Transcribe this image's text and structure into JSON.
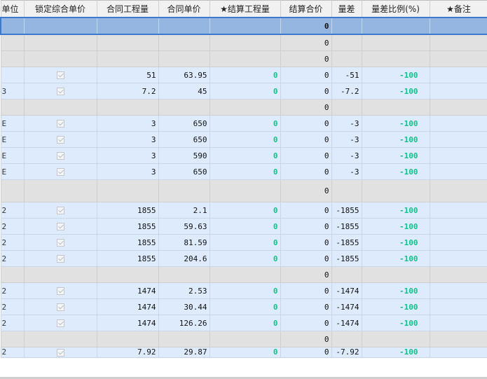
{
  "columns": [
    "单位",
    "锁定综合单价",
    "合同工程量",
    "合同单价",
    "★结算工程量",
    "结算合价",
    "量差",
    "量差比例(%)",
    "★备注"
  ],
  "rows": [
    {
      "type": "selected",
      "cells": [
        "",
        "",
        "",
        "",
        "",
        "0",
        "",
        "",
        ""
      ]
    },
    {
      "type": "group",
      "cells": [
        "",
        "",
        "",
        "",
        "",
        "0",
        "",
        "",
        ""
      ]
    },
    {
      "type": "group",
      "cells": [
        "",
        "",
        "",
        "",
        "",
        "0",
        "",
        "",
        ""
      ]
    },
    {
      "type": "item",
      "cells": [
        "",
        "",
        "51",
        "63.95",
        "0",
        "0",
        "-51",
        "-100",
        ""
      ]
    },
    {
      "type": "item",
      "cells": [
        "3",
        "",
        "7.2",
        "45",
        "0",
        "0",
        "-7.2",
        "-100",
        ""
      ]
    },
    {
      "type": "group",
      "cells": [
        "",
        "",
        "",
        "",
        "",
        "0",
        "",
        "",
        ""
      ]
    },
    {
      "type": "item",
      "cells": [
        "E",
        "",
        "3",
        "650",
        "0",
        "0",
        "-3",
        "-100",
        ""
      ]
    },
    {
      "type": "item",
      "cells": [
        "E",
        "",
        "3",
        "650",
        "0",
        "0",
        "-3",
        "-100",
        ""
      ]
    },
    {
      "type": "item",
      "cells": [
        "E",
        "",
        "3",
        "590",
        "0",
        "0",
        "-3",
        "-100",
        ""
      ]
    },
    {
      "type": "item",
      "cells": [
        "E",
        "",
        "3",
        "650",
        "0",
        "0",
        "-3",
        "-100",
        ""
      ]
    },
    {
      "type": "group tall",
      "cells": [
        "",
        "",
        "",
        "",
        "",
        "0",
        "",
        "",
        ""
      ]
    },
    {
      "type": "item",
      "cells": [
        "2",
        "",
        "1855",
        "2.1",
        "0",
        "0",
        "-1855",
        "-100",
        ""
      ]
    },
    {
      "type": "item",
      "cells": [
        "2",
        "",
        "1855",
        "59.63",
        "0",
        "0",
        "-1855",
        "-100",
        ""
      ]
    },
    {
      "type": "item",
      "cells": [
        "2",
        "",
        "1855",
        "81.59",
        "0",
        "0",
        "-1855",
        "-100",
        ""
      ]
    },
    {
      "type": "item",
      "cells": [
        "2",
        "",
        "1855",
        "204.6",
        "0",
        "0",
        "-1855",
        "-100",
        ""
      ]
    },
    {
      "type": "group",
      "cells": [
        "",
        "",
        "",
        "",
        "",
        "0",
        "",
        "",
        ""
      ]
    },
    {
      "type": "item",
      "cells": [
        "2",
        "",
        "1474",
        "2.53",
        "0",
        "0",
        "-1474",
        "-100",
        ""
      ]
    },
    {
      "type": "item",
      "cells": [
        "2",
        "",
        "1474",
        "30.44",
        "0",
        "0",
        "-1474",
        "-100",
        ""
      ]
    },
    {
      "type": "item",
      "cells": [
        "2",
        "",
        "1474",
        "126.26",
        "0",
        "0",
        "-1474",
        "-100",
        ""
      ]
    },
    {
      "type": "group",
      "cells": [
        "",
        "",
        "",
        "",
        "",
        "0",
        "",
        "",
        ""
      ]
    },
    {
      "type": "item cut",
      "cells": [
        "2",
        "",
        "7.92",
        "29.87",
        "0",
        "0",
        "-7.92",
        "-100",
        ""
      ]
    }
  ],
  "colors": {
    "green_value": "#16c08a",
    "selection": "#3d79cd",
    "item_bg": "#deebfc",
    "group_bg": "#e1e1e1"
  },
  "icons": {
    "lock_checkbox": "checkbox-checked-disabled-icon"
  }
}
